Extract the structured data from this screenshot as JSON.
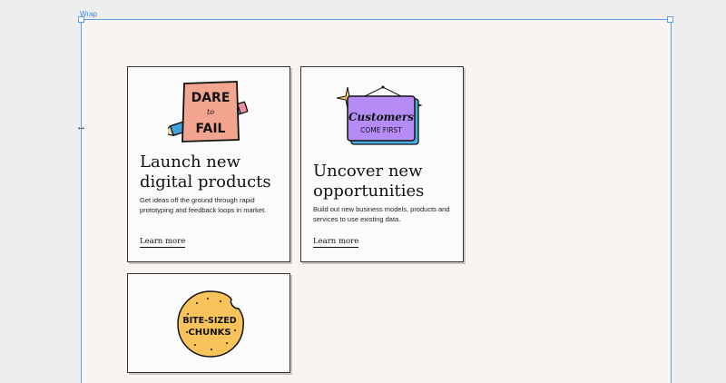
{
  "frame": {
    "label": "Wrap"
  },
  "cards": [
    {
      "illustration_text": [
        "DARE",
        "to",
        "FAIL"
      ],
      "title_lines": [
        "Launch new",
        "digital products"
      ],
      "description_lines": [
        "Get ideas off the ground through rapid",
        "prototyping and feedback loops in market."
      ],
      "link": "Learn more"
    },
    {
      "illustration_text": [
        "Customers",
        "COME FIRST"
      ],
      "title_lines": [
        "Uncover new",
        "opportunities"
      ],
      "description_lines": [
        "Build out new business models, products and",
        "services to use existing data."
      ],
      "link": "Learn more"
    },
    {
      "illustration_text": [
        "BITE-SIZED",
        "CHUNKS"
      ]
    }
  ],
  "colors": {
    "canvas": "#f8f5f1",
    "selection": "#5aa0e8",
    "dare_sign": "#f4a58f",
    "customers_sign": "#b58cf6",
    "cookie": "#f7c35a"
  }
}
